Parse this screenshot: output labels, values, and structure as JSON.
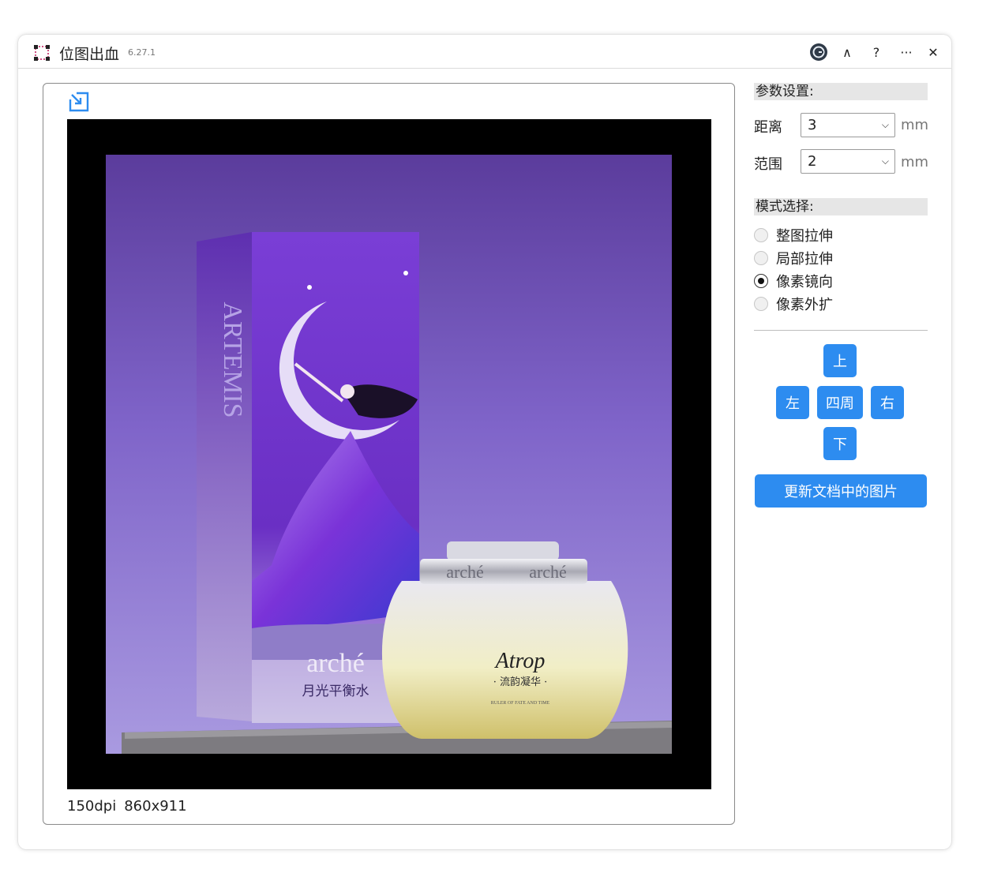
{
  "window": {
    "title": "位图出血",
    "version": "6.27.1",
    "controls": {
      "collapse": "∧",
      "help": "?",
      "more": "···",
      "close": "✕"
    }
  },
  "preview": {
    "dpi": "150dpi",
    "size": "860x911",
    "photo": {
      "box_brand": "arché",
      "box_title": "月光平衡水",
      "box_side_text": "ARTEMIS",
      "jar_brand": "arché",
      "jar_title": "Atrop",
      "jar_subtitle": "· 流韵凝华 ·",
      "jar_small_text": "RULER OF FATE AND TIME"
    }
  },
  "params": {
    "header": "参数设置:",
    "distance": {
      "label": "距离",
      "value": "3",
      "unit": "mm"
    },
    "range": {
      "label": "范围",
      "value": "2",
      "unit": "mm"
    }
  },
  "mode": {
    "header": "模式选择:",
    "options": [
      {
        "label": "整图拉伸",
        "checked": false
      },
      {
        "label": "局部拉伸",
        "checked": false
      },
      {
        "label": "像素镜向",
        "checked": true
      },
      {
        "label": "像素外扩",
        "checked": false
      }
    ]
  },
  "directions": {
    "up": "上",
    "left": "左",
    "around": "四周",
    "right": "右",
    "down": "下"
  },
  "update_button": "更新文档中的图片",
  "colors": {
    "accent": "#2d8cf0",
    "canvas": "#000000",
    "photo_bg": "#7a5cc4"
  }
}
